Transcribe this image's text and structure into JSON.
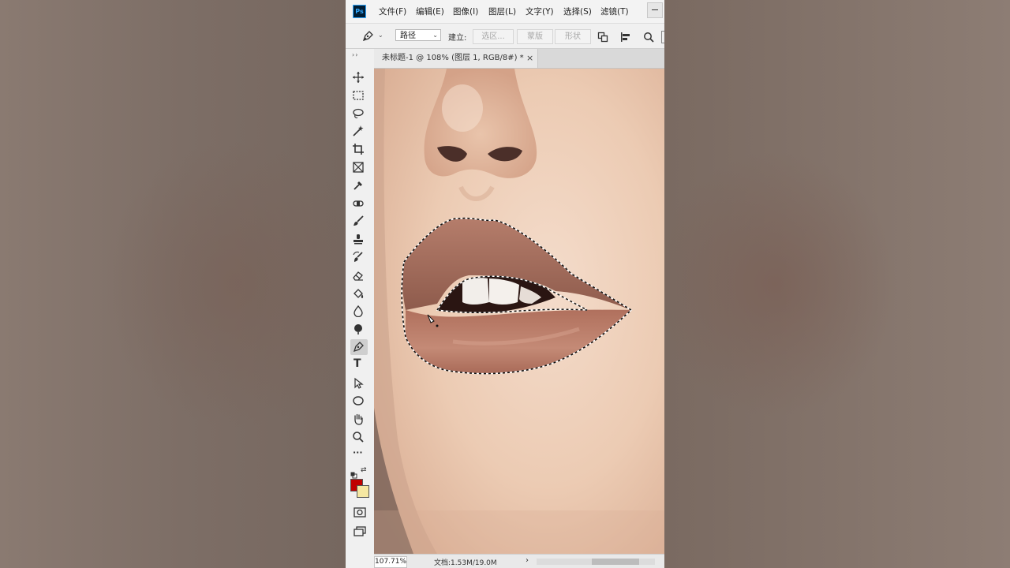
{
  "app": {
    "logo": "Ps"
  },
  "menu": [
    {
      "label": "文件(F)"
    },
    {
      "label": "编辑(E)"
    },
    {
      "label": "图像(I)"
    },
    {
      "label": "图层(L)"
    },
    {
      "label": "文字(Y)"
    },
    {
      "label": "选择(S)"
    },
    {
      "label": "滤镜(T)"
    }
  ],
  "options": {
    "tool_icon": "pen-tool-icon",
    "mode": "路径",
    "build_label": "建立:",
    "selection_btn": "选区...",
    "mask_btn": "蒙版",
    "shape_btn": "形状"
  },
  "document": {
    "tab_title": "未标题-1 @ 108% (图层 1, RGB/8#) *",
    "close": "×"
  },
  "status": {
    "zoom": "107.71%",
    "doc_info": "文档:1.53M/19.0M",
    "arrow": "›"
  },
  "toolbox": {
    "grip": "››",
    "tools": [
      {
        "name": "move-tool-icon"
      },
      {
        "name": "marquee-tool-icon"
      },
      {
        "name": "lasso-tool-icon"
      },
      {
        "name": "magic-wand-tool-icon"
      },
      {
        "name": "crop-tool-icon"
      },
      {
        "name": "frame-tool-icon"
      },
      {
        "name": "eyedropper-tool-icon"
      },
      {
        "name": "healing-brush-tool-icon"
      },
      {
        "name": "brush-tool-icon"
      },
      {
        "name": "clone-stamp-tool-icon"
      },
      {
        "name": "history-brush-tool-icon"
      },
      {
        "name": "eraser-tool-icon"
      },
      {
        "name": "paint-bucket-tool-icon"
      },
      {
        "name": "blur-tool-icon"
      },
      {
        "name": "dodge-tool-icon"
      },
      {
        "name": "pen-tool-icon",
        "active": true
      },
      {
        "name": "type-tool-icon",
        "text": "T"
      },
      {
        "name": "path-selection-tool-icon"
      },
      {
        "name": "ellipse-tool-icon"
      },
      {
        "name": "hand-tool-icon"
      },
      {
        "name": "zoom-tool-icon"
      },
      {
        "name": "more-tools-icon",
        "text": "···"
      }
    ],
    "foreground_color": "#c00000",
    "background_color": "#f5e7a2"
  }
}
